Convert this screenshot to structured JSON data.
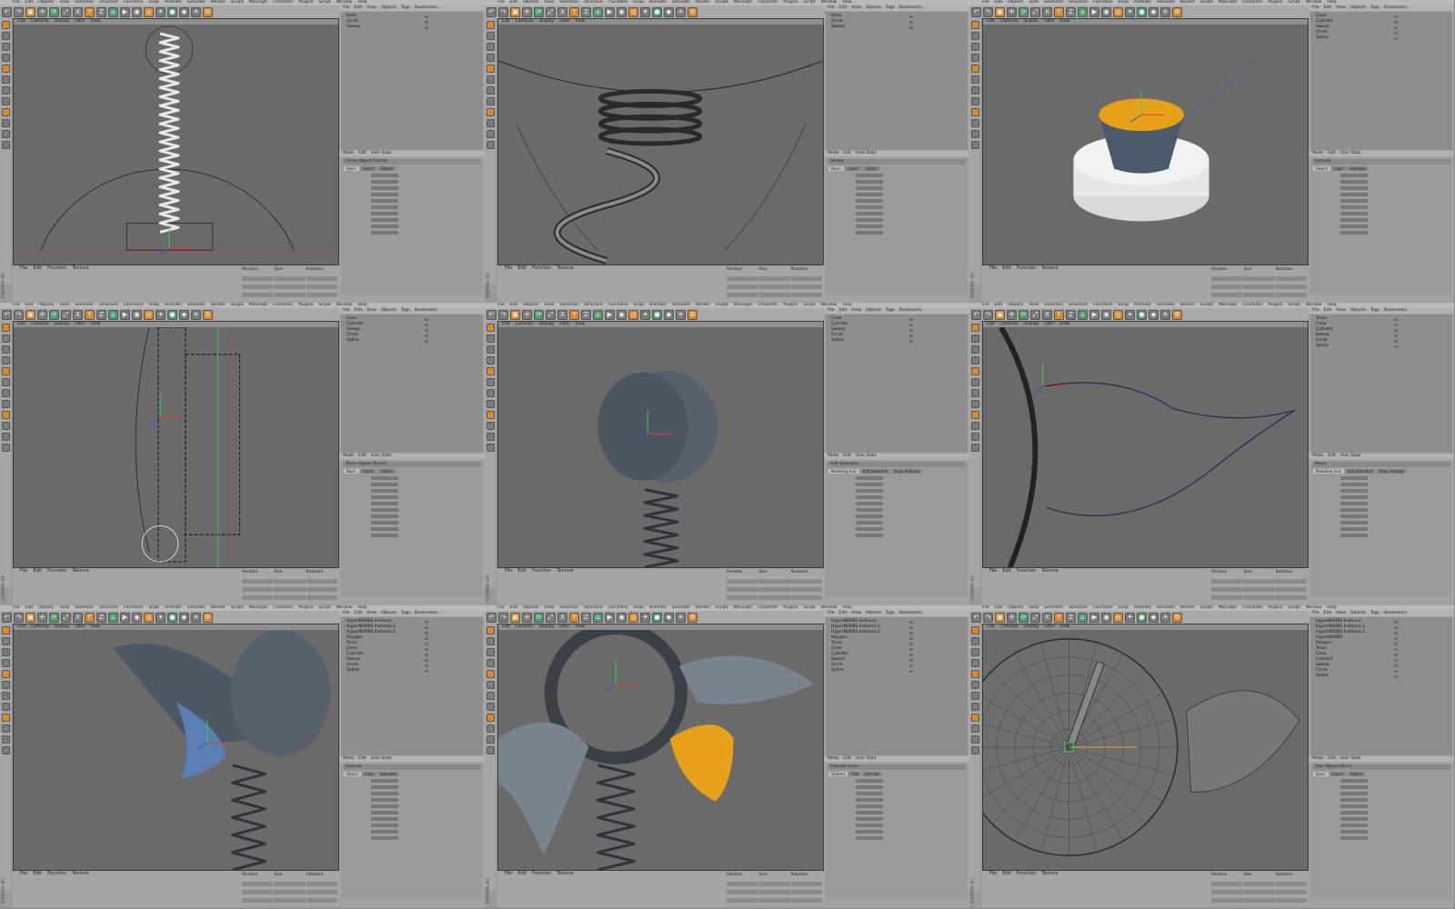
{
  "menus": [
    "File",
    "Edit",
    "Objects",
    "Tools",
    "Selection",
    "Structure",
    "Functions",
    "Snap",
    "Animate",
    "Simulate",
    "Render",
    "Sculpt",
    "MoGraph",
    "Character",
    "Plugins",
    "Script",
    "Window",
    "Help"
  ],
  "viewport_menu": [
    "Edit",
    "Cameras",
    "Display",
    "Filter",
    "View"
  ],
  "timeline_menu": [
    "File",
    "Edit",
    "Function",
    "Texture"
  ],
  "coord_headers": [
    "Position",
    "Size",
    "Rotation"
  ],
  "panel_menu": [
    "File",
    "Edit",
    "View",
    "Objects",
    "Tags",
    "Bookmarks"
  ],
  "attr_menu": [
    "Mode",
    "Edit",
    "User Data"
  ],
  "brand": "CINEMA 4D",
  "toolbar_icons": [
    "↶",
    "↷",
    "▣",
    "✛",
    "⟳",
    "⤢",
    "X",
    "Y",
    "Z",
    "⌂",
    "▶",
    "◉",
    "◎",
    "✦",
    "●",
    "◆",
    "☀",
    "⚙"
  ],
  "colors": {
    "axis_x": "#e23a3a",
    "axis_y": "#3ad04a",
    "axis_z": "#2f4fd8",
    "highlight": "#e8a21a"
  },
  "tiles": [
    {
      "id": "t1",
      "tree": [
        "Helix",
        "Circle",
        "Sweep"
      ],
      "tabs": [
        "Basic",
        "Coord.",
        "Object"
      ],
      "title": "Circle Object [Circle]"
    },
    {
      "id": "t2",
      "tree": [
        "Helix",
        "Circle",
        "Sweep"
      ],
      "tabs": [
        "Basic",
        "Coord.",
        "Object"
      ],
      "title": "Sweep"
    },
    {
      "id": "t3",
      "tree": [
        "Cone",
        "Cylinder",
        "Sweep",
        "Circle",
        "Spline"
      ],
      "tabs": [
        "Object",
        "Caps",
        "Selection"
      ],
      "title": "Extrude"
    },
    {
      "id": "t4",
      "tree": [
        "Cone",
        "Cylinder",
        "Sweep",
        "Circle",
        "Spline"
      ],
      "tabs": [
        "Basic",
        "Coord.",
        "Object"
      ],
      "title": "Torus Object [Torus]"
    },
    {
      "id": "t5",
      "tree": [
        "Cone",
        "Cylinder",
        "Sweep",
        "Circle",
        "Spline"
      ],
      "tabs": [
        "Modeling Axis",
        "Soft Selection",
        "Snap Settings"
      ],
      "title": "Soft Selection"
    },
    {
      "id": "t6",
      "tree": [
        "Torus",
        "Cone",
        "Cylinder",
        "Sweep",
        "Circle",
        "Spline"
      ],
      "tabs": [
        "Modeling Axis",
        "Soft Selection",
        "Snap Settings"
      ],
      "title": "Move"
    },
    {
      "id": "t7",
      "tree": [
        "HyperNURBS.Instance",
        "HyperNURBS.Instance.1",
        "HyperNURBS.Instance.2",
        "Polygon",
        "Torus",
        "Cone",
        "Cylinder",
        "Sweep",
        "Circle",
        "Spline"
      ],
      "tabs": [
        "Object",
        "Caps",
        "Selection"
      ],
      "title": "Extrude"
    },
    {
      "id": "t8",
      "tree": [
        "HyperNURBS.Instance",
        "HyperNURBS.Instance.1",
        "HyperNURBS.Instance.2",
        "Polygon",
        "Torus",
        "Cone",
        "Cylinder",
        "Sweep",
        "Circle",
        "Spline"
      ],
      "tabs": [
        "Options",
        "Tool",
        "Extrude"
      ],
      "title": "Extrude Inner"
    },
    {
      "id": "t9",
      "tree": [
        "HyperNURBS.Instance",
        "HyperNURBS.Instance.1",
        "HyperNURBS.Instance.2",
        "HyperNURBS",
        "Polygon",
        "Torus",
        "Cone",
        "Cylinder",
        "Sweep",
        "Circle",
        "Spline"
      ],
      "tabs": [
        "Basic",
        "Coord.",
        "Object"
      ],
      "title": "Disc Object [Disc]"
    }
  ]
}
